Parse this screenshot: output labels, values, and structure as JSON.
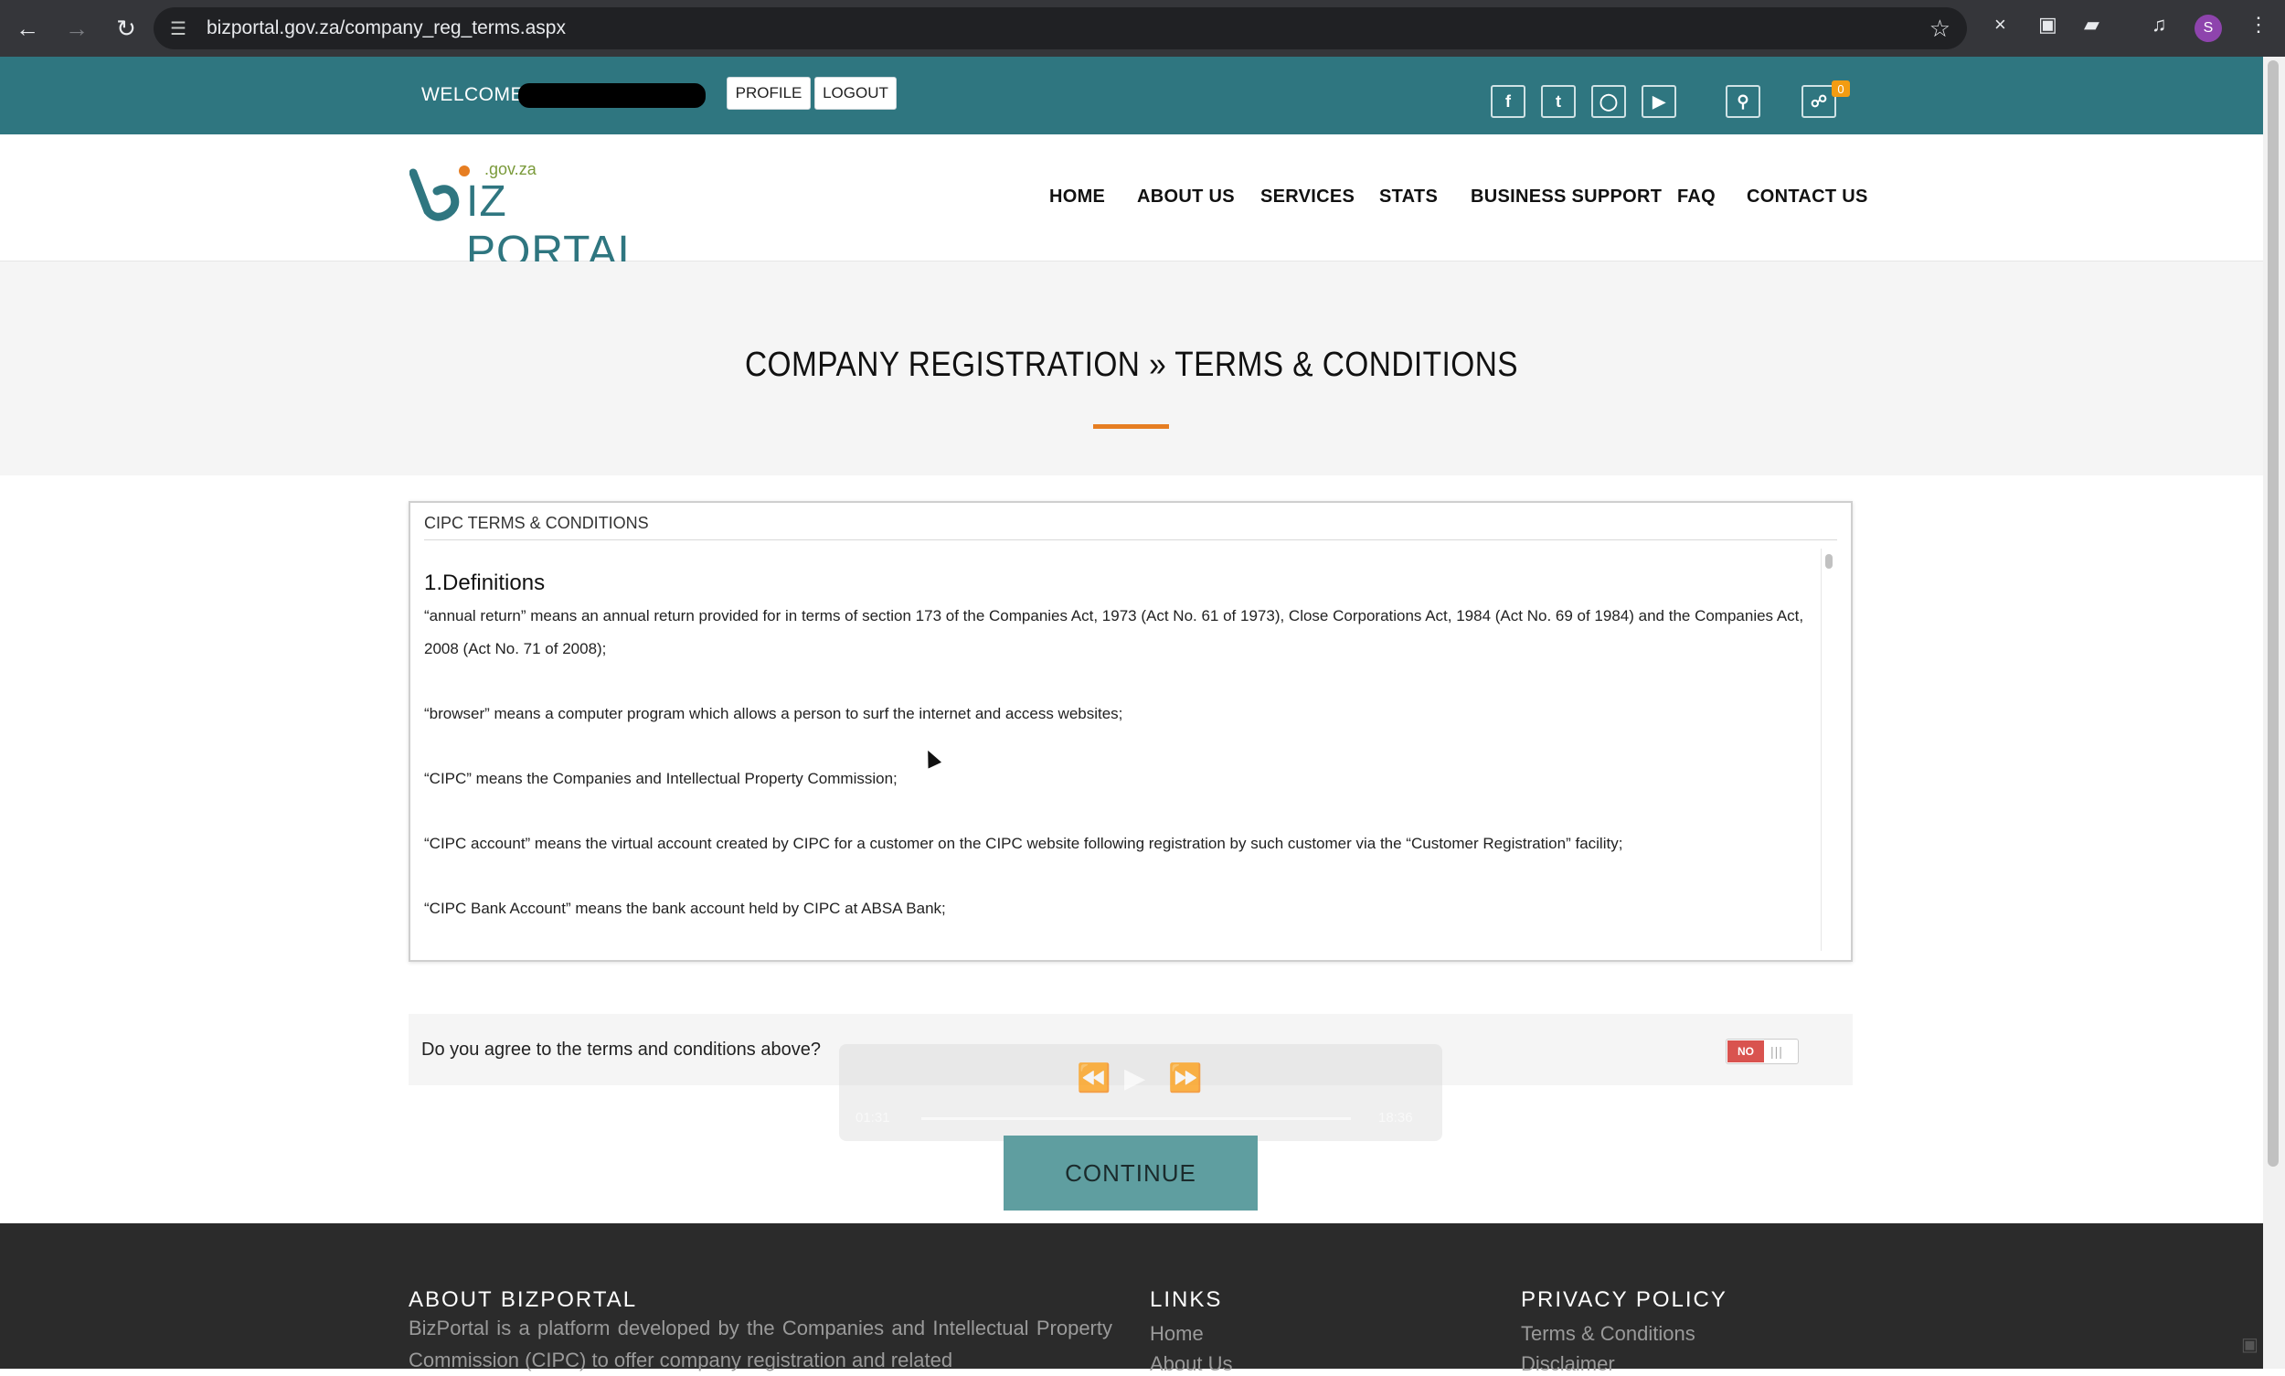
{
  "browser": {
    "url": "bizportal.gov.za/company_reg_terms.aspx",
    "avatar_letter": "S"
  },
  "topbar": {
    "welcome_label": "WELCOME",
    "profile_label": "PROFILE",
    "logout_label": "LOGOUT",
    "social": [
      "facebook-icon",
      "twitter-icon",
      "instagram-icon",
      "youtube-icon"
    ],
    "cart_count": "0"
  },
  "header": {
    "logo_main": "IZ PORTAL",
    "logo_sub": ".gov.za",
    "nav": [
      {
        "label": "HOME"
      },
      {
        "label": "ABOUT US"
      },
      {
        "label": "SERVICES"
      },
      {
        "label": "STATS"
      },
      {
        "label": "BUSINESS SUPPORT"
      },
      {
        "label": "FAQ"
      },
      {
        "label": "CONTACT US"
      }
    ]
  },
  "title": {
    "text": "COMPANY REGISTRATION » TERMS & CONDITIONS",
    "accent_color": "#e67e22"
  },
  "terms": {
    "heading": "CIPC TERMS & CONDITIONS",
    "section_title": "1.Definitions",
    "paragraphs": [
      "“annual return” means an annual return provided for in terms of section 173 of the Companies Act, 1973 (Act No. 61 of 1973), Close Corporations Act, 1984 (Act No. 69 of 1984) and the Companies Act, 2008 (Act No. 71 of 2008);",
      "“browser” means a computer program which allows a person to surf the internet and access websites;",
      "“CIPC” means the Companies and Intellectual Property Commission;",
      "“CIPC account” means the virtual account created by CIPC for a customer on the CIPC website following registration by such customer via the “Customer Registration” facility;",
      "“CIPC Bank Account” means the bank account held by CIPC at ABSA Bank;"
    ]
  },
  "agree": {
    "question": "Do you agree to the terms and conditions above?",
    "toggle_label": "NO",
    "toggle_state": "off"
  },
  "video_overlay": {
    "elapsed": "01:31",
    "total": "18:36"
  },
  "continue_label": "CONTINUE",
  "footer": {
    "about_heading": "ABOUT BIZPORTAL",
    "about_text": "BizPortal is a platform developed by the Companies and Intellectual Property Commission (CIPC) to offer company registration and related",
    "links_heading": "LINKS",
    "links": [
      "Home",
      "About Us"
    ],
    "privacy_heading": "PRIVACY POLICY",
    "privacy_links": [
      "Terms & Conditions",
      "Disclaimer"
    ]
  },
  "colors": {
    "teal": "#2f7680",
    "continue_bg": "#5f9ea0",
    "footer_bg": "#2b2b2b",
    "toggle_no": "#d9534f"
  }
}
